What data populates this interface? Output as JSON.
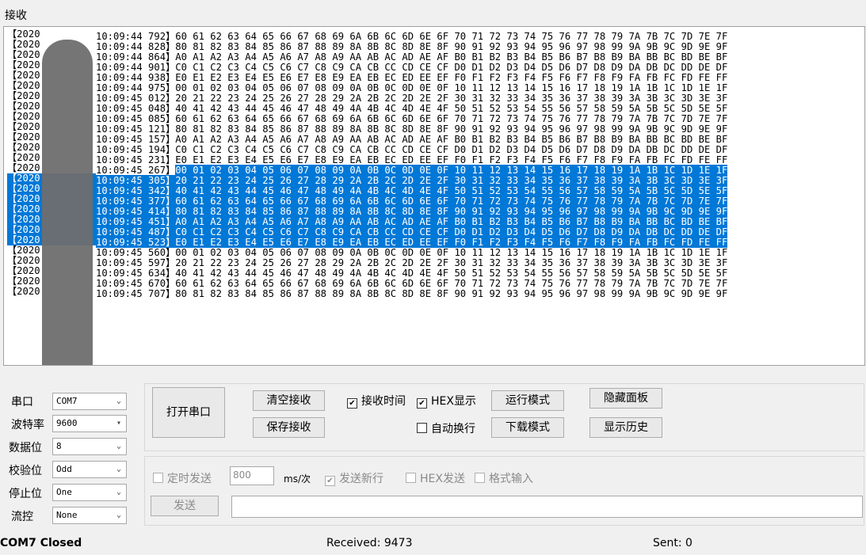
{
  "receive": {
    "title": "接收",
    "date_prefix": "【2020",
    "lines": [
      {
        "time": "10:09:44 792】",
        "hex": "60 61 62 63 64 65 66 67 68 69 6A 6B 6C 6D 6E 6F 70 71 72 73 74 75 76 77 78 79 7A 7B 7C 7D 7E 7F",
        "selected": false
      },
      {
        "time": "10:09:44 828】",
        "hex": "80 81 82 83 84 85 86 87 88 89 8A 8B 8C 8D 8E 8F 90 91 92 93 94 95 96 97 98 99 9A 9B 9C 9D 9E 9F",
        "selected": false
      },
      {
        "time": "10:09:44 864】",
        "hex": "A0 A1 A2 A3 A4 A5 A6 A7 A8 A9 AA AB AC AD AE AF B0 B1 B2 B3 B4 B5 B6 B7 B8 B9 BA BB BC BD BE BF",
        "selected": false
      },
      {
        "time": "10:09:44 901】",
        "hex": "C0 C1 C2 C3 C4 C5 C6 C7 C8 C9 CA CB CC CD CE CF D0 D1 D2 D3 D4 D5 D6 D7 D8 D9 DA DB DC DD DE DF",
        "selected": false
      },
      {
        "time": "10:09:44 938】",
        "hex": "E0 E1 E2 E3 E4 E5 E6 E7 E8 E9 EA EB EC ED EE EF F0 F1 F2 F3 F4 F5 F6 F7 F8 F9 FA FB FC FD FE FF",
        "selected": false
      },
      {
        "time": "10:09:44 975】",
        "hex": "00 01 02 03 04 05 06 07 08 09 0A 0B 0C 0D 0E 0F 10 11 12 13 14 15 16 17 18 19 1A 1B 1C 1D 1E 1F",
        "selected": false
      },
      {
        "time": "10:09:45 012】",
        "hex": "20 21 22 23 24 25 26 27 28 29 2A 2B 2C 2D 2E 2F 30 31 32 33 34 35 36 37 38 39 3A 3B 3C 3D 3E 3F",
        "selected": false
      },
      {
        "time": "10:09:45 048】",
        "hex": "40 41 42 43 44 45 46 47 48 49 4A 4B 4C 4D 4E 4F 50 51 52 53 54 55 56 57 58 59 5A 5B 5C 5D 5E 5F",
        "selected": false
      },
      {
        "time": "10:09:45 085】",
        "hex": "60 61 62 63 64 65 66 67 68 69 6A 6B 6C 6D 6E 6F 70 71 72 73 74 75 76 77 78 79 7A 7B 7C 7D 7E 7F",
        "selected": false
      },
      {
        "time": "10:09:45 121】",
        "hex": "80 81 82 83 84 85 86 87 88 89 8A 8B 8C 8D 8E 8F 90 91 92 93 94 95 96 97 98 99 9A 9B 9C 9D 9E 9F",
        "selected": false
      },
      {
        "time": "10:09:45 157】",
        "hex": "A0 A1 A2 A3 A4 A5 A6 A7 A8 A9 AA AB AC AD AE AF B0 B1 B2 B3 B4 B5 B6 B7 B8 B9 BA BB BC BD BE BF",
        "selected": false
      },
      {
        "time": "10:09:45 194】",
        "hex": "C0 C1 C2 C3 C4 C5 C6 C7 C8 C9 CA CB CC CD CE CF D0 D1 D2 D3 D4 D5 D6 D7 D8 D9 DA DB DC DD DE DF",
        "selected": false
      },
      {
        "time": "10:09:45 231】",
        "hex": "E0 E1 E2 E3 E4 E5 E6 E7 E8 E9 EA EB EC ED EE EF F0 F1 F2 F3 F4 F5 F6 F7 F8 F9 FA FB FC FD FE FF",
        "selected": false
      },
      {
        "time": "10:09:45 267】",
        "hex": "00 01 02 03 04 05 06 07 08 09 0A 0B 0C 0D 0E 0F 10 11 12 13 14 15 16 17 18 19 1A 1B 1C 1D 1E 1F",
        "selected": "hex"
      },
      {
        "time": "10:09:45 305】",
        "hex": "20 21 22 23 24 25 26 27 28 29 2A 2B 2C 2D 2E 2F 30 31 32 33 34 35 36 37 38 39 3A 3B 3C 3D 3E 3F",
        "selected": true
      },
      {
        "time": "10:09:45 342】",
        "hex": "40 41 42 43 44 45 46 47 48 49 4A 4B 4C 4D 4E 4F 50 51 52 53 54 55 56 57 58 59 5A 5B 5C 5D 5E 5F",
        "selected": true
      },
      {
        "time": "10:09:45 377】",
        "hex": "60 61 62 63 64 65 66 67 68 69 6A 6B 6C 6D 6E 6F 70 71 72 73 74 75 76 77 78 79 7A 7B 7C 7D 7E 7F",
        "selected": true
      },
      {
        "time": "10:09:45 414】",
        "hex": "80 81 82 83 84 85 86 87 88 89 8A 8B 8C 8D 8E 8F 90 91 92 93 94 95 96 97 98 99 9A 9B 9C 9D 9E 9F",
        "selected": true
      },
      {
        "time": "10:09:45 451】",
        "hex": "A0 A1 A2 A3 A4 A5 A6 A7 A8 A9 AA AB AC AD AE AF B0 B1 B2 B3 B4 B5 B6 B7 B8 B9 BA BB BC BD BE BF",
        "selected": true
      },
      {
        "time": "10:09:45 487】",
        "hex": "C0 C1 C2 C3 C4 C5 C6 C7 C8 C9 CA CB CC CD CE CF D0 D1 D2 D3 D4 D5 D6 D7 D8 D9 DA DB DC DD DE DF",
        "selected": true
      },
      {
        "time": "10:09:45 523】",
        "hex": "E0 E1 E2 E3 E4 E5 E6 E7 E8 E9 EA EB EC ED EE EF F0 F1 F2 F3 F4 F5 F6 F7 F8 F9 FA FB FC FD FE FF",
        "selected": true
      },
      {
        "time": "10:09:45 560】",
        "hex": "00 01 02 03 04 05 06 07 08 09 0A 0B 0C 0D 0E 0F 10 11 12 13 14 15 16 17 18 19 1A 1B 1C 1D 1E 1F",
        "selected": false
      },
      {
        "time": "10:09:45 597】",
        "hex": "20 21 22 23 24 25 26 27 28 29 2A 2B 2C 2D 2E 2F 30 31 32 33 34 35 36 37 38 39 3A 3B 3C 3D 3E 3F",
        "selected": false
      },
      {
        "time": "10:09:45 634】",
        "hex": "40 41 42 43 44 45 46 47 48 49 4A 4B 4C 4D 4E 4F 50 51 52 53 54 55 56 57 58 59 5A 5B 5C 5D 5E 5F",
        "selected": false
      },
      {
        "time": "10:09:45 670】",
        "hex": "60 61 62 63 64 65 66 67 68 69 6A 6B 6C 6D 6E 6F 70 71 72 73 74 75 76 77 78 79 7A 7B 7C 7D 7E 7F",
        "selected": false
      },
      {
        "time": "10:09:45 707】",
        "hex": "80 81 82 83 84 85 86 87 88 89 8A 8B 8C 8D 8E 8F 90 91 92 93 94 95 96 97 98 99 9A 9B 9C 9D 9E 9F",
        "selected": false
      }
    ]
  },
  "settings": {
    "port_label": "串口",
    "port_value": "COM7",
    "baud_label": "波特率",
    "baud_value": "9600",
    "databits_label": "数据位",
    "databits_value": "8",
    "parity_label": "校验位",
    "parity_value": "Odd",
    "stopbits_label": "停止位",
    "stopbits_value": "One",
    "flow_label": "流控",
    "flow_value": "None"
  },
  "buttons": {
    "open_port": "打开串口",
    "clear_receive": "清空接收",
    "save_receive": "保存接收",
    "run_mode": "运行模式",
    "download_mode": "下载模式",
    "hide_panel": "隐藏面板",
    "show_history": "显示历史",
    "send": "发送"
  },
  "options": {
    "recv_time": "接收时间",
    "recv_time_checked": true,
    "hex_display": "HEX显示",
    "hex_display_checked": true,
    "auto_wrap": "自动换行",
    "auto_wrap_checked": false
  },
  "send_opts": {
    "timed_send": "定时发送",
    "interval_value": "800",
    "interval_unit": "ms/次",
    "send_newline": "发送新行",
    "send_newline_checked": true,
    "hex_send": "HEX发送",
    "format_input": "格式输入",
    "send_text": ""
  },
  "status": {
    "port_state": "COM7 Closed",
    "received": "Received: 9473",
    "sent": "Sent: 0"
  },
  "icons": {
    "check": "✔",
    "dropdown": "chevron-down-icon"
  }
}
